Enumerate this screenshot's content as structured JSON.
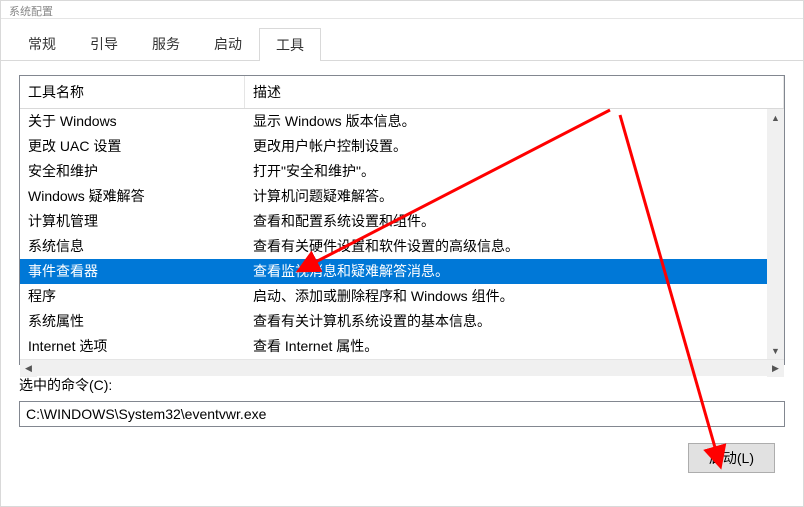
{
  "titlebar": "系统配置",
  "tabs": [
    {
      "label": "常规",
      "active": false
    },
    {
      "label": "引导",
      "active": false
    },
    {
      "label": "服务",
      "active": false
    },
    {
      "label": "启动",
      "active": false
    },
    {
      "label": "工具",
      "active": true
    }
  ],
  "columns": {
    "name": "工具名称",
    "desc": "描述"
  },
  "rows": [
    {
      "name": "关于 Windows",
      "desc": "显示 Windows 版本信息。",
      "selected": false
    },
    {
      "name": "更改 UAC 设置",
      "desc": "更改用户帐户控制设置。",
      "selected": false
    },
    {
      "name": "安全和维护",
      "desc": "打开\"安全和维护\"。",
      "selected": false
    },
    {
      "name": "Windows 疑难解答",
      "desc": "计算机问题疑难解答。",
      "selected": false
    },
    {
      "name": "计算机管理",
      "desc": "查看和配置系统设置和组件。",
      "selected": false
    },
    {
      "name": "系统信息",
      "desc": "查看有关硬件设置和软件设置的高级信息。",
      "selected": false
    },
    {
      "name": "事件查看器",
      "desc": "查看监视消息和疑难解答消息。",
      "selected": true
    },
    {
      "name": "程序",
      "desc": "启动、添加或删除程序和 Windows 组件。",
      "selected": false
    },
    {
      "name": "系统属性",
      "desc": "查看有关计算机系统设置的基本信息。",
      "selected": false
    },
    {
      "name": "Internet 选项",
      "desc": "查看 Internet 属性。",
      "selected": false
    }
  ],
  "command": {
    "label": "选中的命令(C):",
    "value": "C:\\WINDOWS\\System32\\eventvwr.exe"
  },
  "buttons": {
    "launch": "启动(L)"
  },
  "annotation": {
    "color": "#ff0000"
  }
}
